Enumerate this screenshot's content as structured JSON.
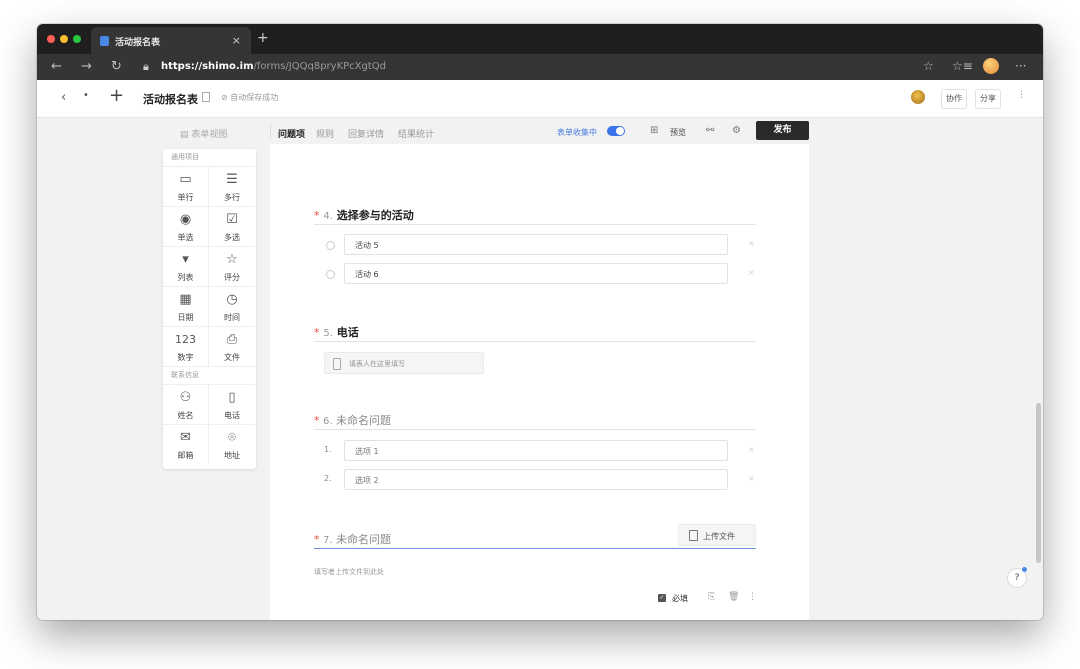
{
  "browser": {
    "tab_title": "活动报名表",
    "tab_close": "×",
    "new_tab": "+",
    "url_host": "https://shimo.im",
    "url_path": "/forms/JQQq8pryKPcXgtQd",
    "back": "←",
    "forward": "→",
    "reload": "↻",
    "star": "☆",
    "collections": "☆≡",
    "menu": "···"
  },
  "header": {
    "back": "‹",
    "dropdown": "•",
    "add": "+",
    "doc_title": "活动报名表",
    "autosave": "⊘ 自动保存成功",
    "collab_label": "协作",
    "share_label": "分享",
    "more": "⋮"
  },
  "palette": {
    "toggle_label": "表单视图",
    "sections": [
      {
        "title": "通用项目",
        "items": [
          {
            "label": "单行",
            "icon": "▭"
          },
          {
            "label": "多行",
            "icon": "☰"
          },
          {
            "label": "单选",
            "icon": "◉"
          },
          {
            "label": "多选",
            "icon": "☑"
          },
          {
            "label": "列表",
            "icon": "▾"
          },
          {
            "label": "评分",
            "icon": "☆"
          },
          {
            "label": "日期",
            "icon": "▦"
          },
          {
            "label": "时间",
            "icon": "◷"
          },
          {
            "label": "数字",
            "icon": "123"
          },
          {
            "label": "文件",
            "icon": "⎙"
          }
        ]
      },
      {
        "title": "联系信息",
        "items": [
          {
            "label": "姓名",
            "icon": "⚇"
          },
          {
            "label": "电话",
            "icon": "▯"
          },
          {
            "label": "邮箱",
            "icon": "✉"
          },
          {
            "label": "地址",
            "icon": "⌾"
          }
        ]
      }
    ]
  },
  "topbar": {
    "tabs": [
      "问题项",
      "规则",
      "回复详情",
      "结果统计"
    ],
    "active_tab": 0,
    "collect_label": "表单收集中",
    "preview_label": "预览",
    "publish_label": "发布",
    "grid_icon": "⊞",
    "link_icon": "⚯",
    "settings_icon": "⚙"
  },
  "questions": {
    "q4": {
      "required": "*",
      "number": "4.",
      "title": "选择参与的活动",
      "options": [
        "活动 5",
        "活动 6"
      ]
    },
    "q5": {
      "required": "*",
      "number": "5.",
      "title": "电话",
      "placeholder": "填表人在这里填写"
    },
    "q6": {
      "required": "*",
      "number": "6.",
      "title": "未命名问题",
      "options": [
        {
          "index": "1.",
          "label": "选项 1"
        },
        {
          "index": "2.",
          "label": "选项 2"
        }
      ]
    },
    "q7": {
      "required": "*",
      "number": "7.",
      "title": "未命名问题",
      "upload_label": "上传文件",
      "hint": "填写者上传文件到此处"
    },
    "footer": {
      "required_label": "必填",
      "copy_icon": "⎘",
      "delete_icon": "🗑",
      "more_icon": "⋮",
      "checkbox": "✓"
    },
    "remove_mark": "×"
  },
  "help": {
    "label": "?"
  }
}
